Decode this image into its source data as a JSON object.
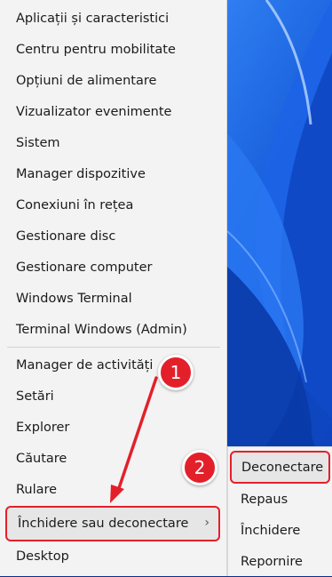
{
  "menu": {
    "items": [
      {
        "label": "Aplicații și caracteristici"
      },
      {
        "label": "Centru pentru mobilitate"
      },
      {
        "label": "Opțiuni de alimentare"
      },
      {
        "label": "Vizualizator evenimente"
      },
      {
        "label": "Sistem"
      },
      {
        "label": "Manager dispozitive"
      },
      {
        "label": "Conexiuni în rețea"
      },
      {
        "label": "Gestionare disc"
      },
      {
        "label": "Gestionare computer"
      },
      {
        "label": "Windows Terminal"
      },
      {
        "label": "Terminal Windows (Admin)"
      },
      {
        "label": "Manager de activități"
      },
      {
        "label": "Setări"
      },
      {
        "label": "Explorer"
      },
      {
        "label": "Căutare"
      },
      {
        "label": "Rulare"
      },
      {
        "label": "Închidere sau deconectare"
      },
      {
        "label": "Desktop"
      }
    ]
  },
  "submenu": {
    "items": [
      {
        "label": "Deconectare"
      },
      {
        "label": "Repaus"
      },
      {
        "label": "Închidere"
      },
      {
        "label": "Repornire"
      }
    ]
  },
  "annotations": {
    "step1": "1",
    "step2": "2"
  },
  "icons": {
    "submenu_arrow": "chevron-right-icon"
  },
  "colors": {
    "highlight": "#e3202a",
    "menu_bg": "#f3f3f3",
    "wallpaper": "#1565e0"
  }
}
